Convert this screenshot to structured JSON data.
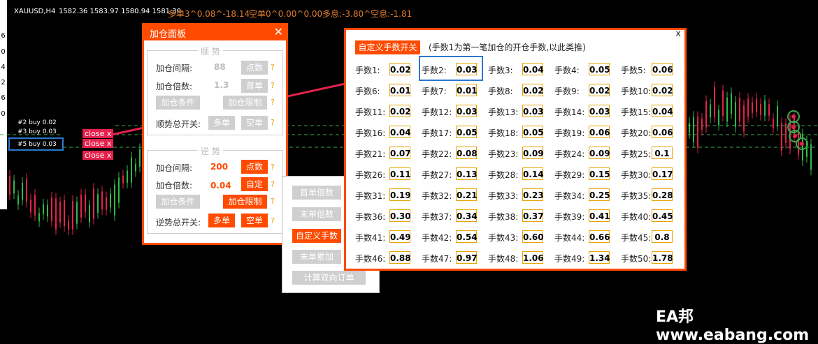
{
  "chart": {
    "symbol": "XAUUSD,H4",
    "ohlc": "1582.36 1583.97 1580.94 1581.30",
    "buy_stat": "多单3^0.08^-18.14",
    "sell_stat": "空单0^0.00^0.00",
    "interest": "多息:-3.80^空息:-1.81",
    "side_numbers": [
      "6",
      "0",
      "4",
      "2",
      "6",
      "0"
    ],
    "trades": [
      "#2 buy 0.02",
      "#3 buy 0.03",
      "#5 buy 0.03"
    ],
    "close_label": "close x",
    "watermark": "EA邦 www.eabang.com"
  },
  "add_panel": {
    "title": "加仓面板",
    "close": "✕",
    "trend": {
      "title": "顺 势",
      "interval_label": "加仓间隔:",
      "interval_value": "88",
      "interval_btn": "点数",
      "multiplier_label": "加仓倍数:",
      "multiplier_value": "1.3",
      "multiplier_btn": "首单",
      "condition_btn": "加仓条件",
      "limit_btn": "加仓限制",
      "switch_label": "顺势总开关:",
      "long_btn": "多单",
      "short_btn": "空单"
    },
    "counter": {
      "title": "逆 势",
      "interval_label": "加仓间隔:",
      "interval_value": "200",
      "interval_btn": "点数",
      "multiplier_label": "加仓倍数:",
      "multiplier_value": "0.04",
      "multiplier_btn": "自定",
      "condition_btn": "加仓条件",
      "limit_btn": "加仓限制",
      "switch_label": "逆势总开关:",
      "long_btn": "多单",
      "short_btn": "空单"
    },
    "help": "?"
  },
  "mid_panel": {
    "buttons": [
      "首单倍数",
      "末单倍数",
      "自定义手数",
      "末单累加",
      "计算双向订单"
    ]
  },
  "lots_panel": {
    "close": "x",
    "custom_btn": "自定义手数开关",
    "note": "(手数1为第一笔加仓的开仓手数,以此类推)",
    "lots": [
      {
        "label": "手数1:",
        "value": "0.02"
      },
      {
        "label": "手数2:",
        "value": "0.03"
      },
      {
        "label": "手数3:",
        "value": "0.04"
      },
      {
        "label": "手数4:",
        "value": "0.05"
      },
      {
        "label": "手数5:",
        "value": "0.06"
      },
      {
        "label": "手数6:",
        "value": "0.01"
      },
      {
        "label": "手数7:",
        "value": "0.01"
      },
      {
        "label": "手数8:",
        "value": "0.02"
      },
      {
        "label": "手数9:",
        "value": "0.02"
      },
      {
        "label": "手数10:",
        "value": "0.02"
      },
      {
        "label": "手数11:",
        "value": "0.02"
      },
      {
        "label": "手数12:",
        "value": "0.03"
      },
      {
        "label": "手数13:",
        "value": "0.03"
      },
      {
        "label": "手数14:",
        "value": "0.03"
      },
      {
        "label": "手数15:",
        "value": "0.04"
      },
      {
        "label": "手数16:",
        "value": "0.04"
      },
      {
        "label": "手数17:",
        "value": "0.05"
      },
      {
        "label": "手数18:",
        "value": "0.05"
      },
      {
        "label": "手数19:",
        "value": "0.06"
      },
      {
        "label": "手数20:",
        "value": "0.06"
      },
      {
        "label": "手数21:",
        "value": "0.07"
      },
      {
        "label": "手数22:",
        "value": "0.08"
      },
      {
        "label": "手数23:",
        "value": "0.09"
      },
      {
        "label": "手数24:",
        "value": "0.09"
      },
      {
        "label": "手数25:",
        "value": "0.1"
      },
      {
        "label": "手数26:",
        "value": "0.11"
      },
      {
        "label": "手数27:",
        "value": "0.13"
      },
      {
        "label": "手数28:",
        "value": "0.14"
      },
      {
        "label": "手数29:",
        "value": "0.15"
      },
      {
        "label": "手数30:",
        "value": "0.17"
      },
      {
        "label": "手数31:",
        "value": "0.19"
      },
      {
        "label": "手数32:",
        "value": "0.21"
      },
      {
        "label": "手数33:",
        "value": "0.23"
      },
      {
        "label": "手数34:",
        "value": "0.25"
      },
      {
        "label": "手数35:",
        "value": "0.28"
      },
      {
        "label": "手数36:",
        "value": "0.30"
      },
      {
        "label": "手数37:",
        "value": "0.34"
      },
      {
        "label": "手数38:",
        "value": "0.37"
      },
      {
        "label": "手数39:",
        "value": "0.41"
      },
      {
        "label": "手数40:",
        "value": "0.45"
      },
      {
        "label": "手数41:",
        "value": "0.49"
      },
      {
        "label": "手数42:",
        "value": "0.54"
      },
      {
        "label": "手数43:",
        "value": "0.60"
      },
      {
        "label": "手数44:",
        "value": "0.66"
      },
      {
        "label": "手数45:",
        "value": "0.8"
      },
      {
        "label": "手数46:",
        "value": "0.88"
      },
      {
        "label": "手数47:",
        "value": "0.97"
      },
      {
        "label": "手数48:",
        "value": "1.06"
      },
      {
        "label": "手数49:",
        "value": "1.34"
      },
      {
        "label": "手数50:",
        "value": "1.78"
      }
    ]
  },
  "colors": {
    "accent": "#ff4a00",
    "close_red": "#e5214d",
    "highlight_blue": "#2a78d0",
    "candle_red": "#e5214d",
    "candle_green": "#2fb94a"
  }
}
